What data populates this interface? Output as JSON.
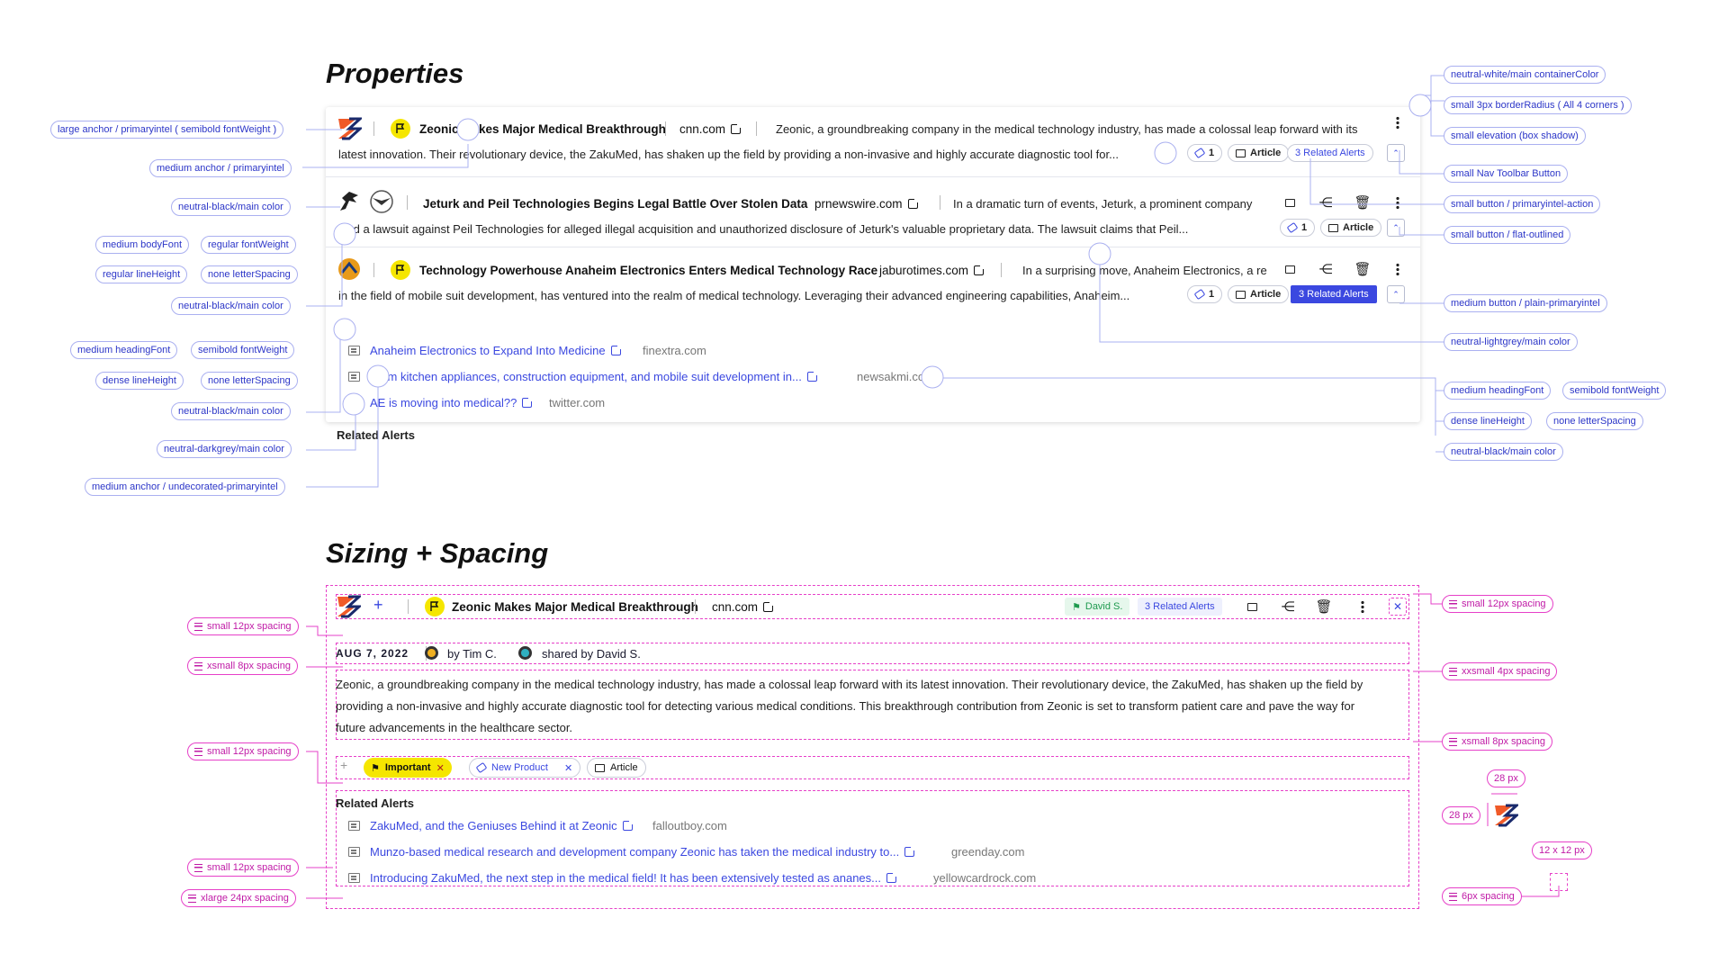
{
  "properties": {
    "title": "Properties",
    "rows": [
      {
        "headline": "Zeonic Makes Major Medical Breakthrough",
        "domain": "cnn.com",
        "snippet1": "Zeonic, a groundbreaking company in the medical technology industry, has made a colossal leap forward with its",
        "snippet2": "latest innovation. Their revolutionary device, the ZakuMed, has shaken up the field by  providing a non-invasive and highly accurate diagnostic tool for...",
        "tag_count": "1",
        "article": "Article",
        "related": "3 Related Alerts"
      },
      {
        "headline": "Jeturk and Peil Technologies Begins Legal Battle Over Stolen Data",
        "domain": "prnewswire.com",
        "snippet1": "In a dramatic turn of events, Jeturk, a prominent company",
        "snippet2": "filed a lawsuit against Peil Technologies for alleged illegal acquisition and unauthorized  disclosure of Jeturk's valuable proprietary data. The lawsuit claims that Peil...",
        "tag_count": "1",
        "article": "Article"
      },
      {
        "headline": "Technology Powerhouse Anaheim Electronics Enters Medical Technology Race",
        "domain": "jaburotimes.com",
        "snippet1": "In a surprising move, Anaheim Electronics, a re",
        "snippet2": "in the field of mobile suit development, has ventured into the realm of medical technology.  Leveraging their advanced engineering capabilities, Anaheim...",
        "tag_count": "1",
        "article": "Article",
        "related": "3 Related Alerts"
      }
    ],
    "related_heading": "Related Alerts",
    "related": [
      {
        "title": "Anaheim Electronics to Expand Into Medicine",
        "domain": "finextra.com"
      },
      {
        "title": "From kitchen appliances, construction equipment, and mobile suit development in...",
        "domain": "newsakmi.com"
      },
      {
        "title": "AE is moving into medical??",
        "domain": "twitter.com"
      }
    ],
    "left_annotations": [
      {
        "a": "large anchor / primaryintel ( semibold fontWeight )"
      },
      {
        "a": "medium anchor / primaryintel"
      },
      {
        "a": "neutral-black/main color"
      },
      {
        "a": "medium bodyFont",
        "b": "regular fontWeight"
      },
      {
        "a": "regular lineHeight",
        "b": "none letterSpacing"
      },
      {
        "a": "neutral-black/main color"
      },
      {
        "a": "medium headingFont",
        "b": "semibold fontWeight"
      },
      {
        "a": "dense lineHeight",
        "b": "none letterSpacing"
      },
      {
        "a": "neutral-black/main color"
      },
      {
        "a": "neutral-darkgrey/main color"
      },
      {
        "a": "medium anchor / undecorated-primaryintel"
      }
    ],
    "right_annotations": [
      "neutral-white/main containerColor",
      "small 3px borderRadius ( All 4 corners )",
      "small elevation (box shadow)",
      "small Nav Toolbar Button",
      "small button / primaryintel-action",
      "small button / flat-outlined",
      "medium button / plain-primaryintel",
      "neutral-lightgrey/main color",
      "medium headingFont",
      "semibold fontWeight",
      "dense lineHeight",
      "none letterSpacing",
      "neutral-black/main color"
    ]
  },
  "sizing": {
    "title": "Sizing + Spacing",
    "headline": "Zeonic Makes Major Medical Breakthrough",
    "domain": "cnn.com",
    "bookmark": "David S.",
    "related_btn": "3 Related Alerts",
    "date": "AUG 7, 2022",
    "by": "by Tim C.",
    "shared": "shared by David S.",
    "body": [
      "Zeonic, a groundbreaking company in the medical technology industry, has made a colossal leap forward with its latest innovation. Their revolutionary device, the ZakuMed, has shaken up the field by",
      "providing a non-invasive and highly accurate diagnostic tool for detecting various medical conditions. This breakthrough contribution from Zeonic is set to transform patient care and pave the way for",
      "future advancements in the healthcare sector."
    ],
    "tags": {
      "important": "Important",
      "new_product": "New Product",
      "article": "Article"
    },
    "related_heading": "Related Alerts",
    "related": [
      {
        "title": "ZakuMed, and the Geniuses Behind it at Zeonic",
        "domain": "falloutboy.com"
      },
      {
        "title": "Munzo-based medical research and development company Zeonic has taken the medical industry to...",
        "domain": "greenday.com"
      },
      {
        "title": "Introducing ZakuMed, the next step in the medical field! It has been extensively tested as ananes...",
        "domain": "yellowcardrock.com"
      }
    ],
    "left_annotations": [
      "small 12px spacing",
      "xsmall 8px spacing",
      "small 12px spacing",
      "small 12px spacing",
      "xlarge 24px spacing"
    ],
    "right_annotations": [
      "small 12px spacing",
      "xxsmall 4px spacing",
      "xsmall 8px spacing",
      "6px spacing"
    ],
    "dims": {
      "w": "28 px",
      "h": "28 px",
      "icon": "12 x 12 px"
    }
  },
  "colors": {
    "primary": "#3b48e0",
    "magenta": "#e640c8",
    "flag": "#f5e600",
    "pill": "#aab0f0"
  }
}
